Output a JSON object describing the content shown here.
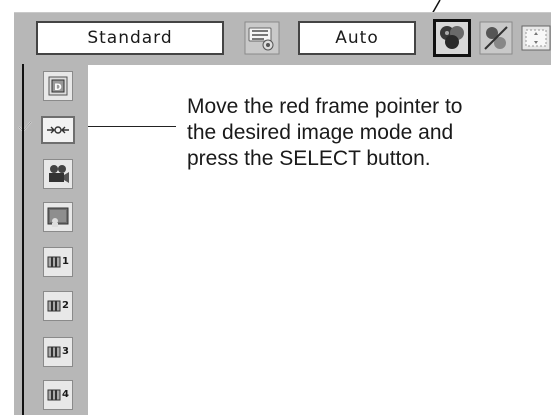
{
  "menu_bar": {
    "image_mode_value": "Standard",
    "screen_mode_value": "Auto",
    "icons": [
      "image-adjust-menu-icon",
      "image-select-icon",
      "color-adjust-icon",
      "screen-icon"
    ]
  },
  "sidebar": {
    "items": [
      {
        "icon": "dynamic-icon",
        "label": ""
      },
      {
        "icon": "standard-icon",
        "label": "",
        "selected": true
      },
      {
        "icon": "cinema-icon",
        "label": ""
      },
      {
        "icon": "blackboard-icon",
        "label": ""
      },
      {
        "icon": "image-icon",
        "label": "1"
      },
      {
        "icon": "image-icon",
        "label": "2"
      },
      {
        "icon": "image-icon",
        "label": "3"
      },
      {
        "icon": "image-icon",
        "label": "4"
      }
    ]
  },
  "callout": {
    "lines": [
      "Move the red frame pointer to",
      "the desired image mode and",
      "press the SELECT button."
    ]
  },
  "colors": {
    "panel": "#b7b7b7",
    "frame": "#111111"
  }
}
